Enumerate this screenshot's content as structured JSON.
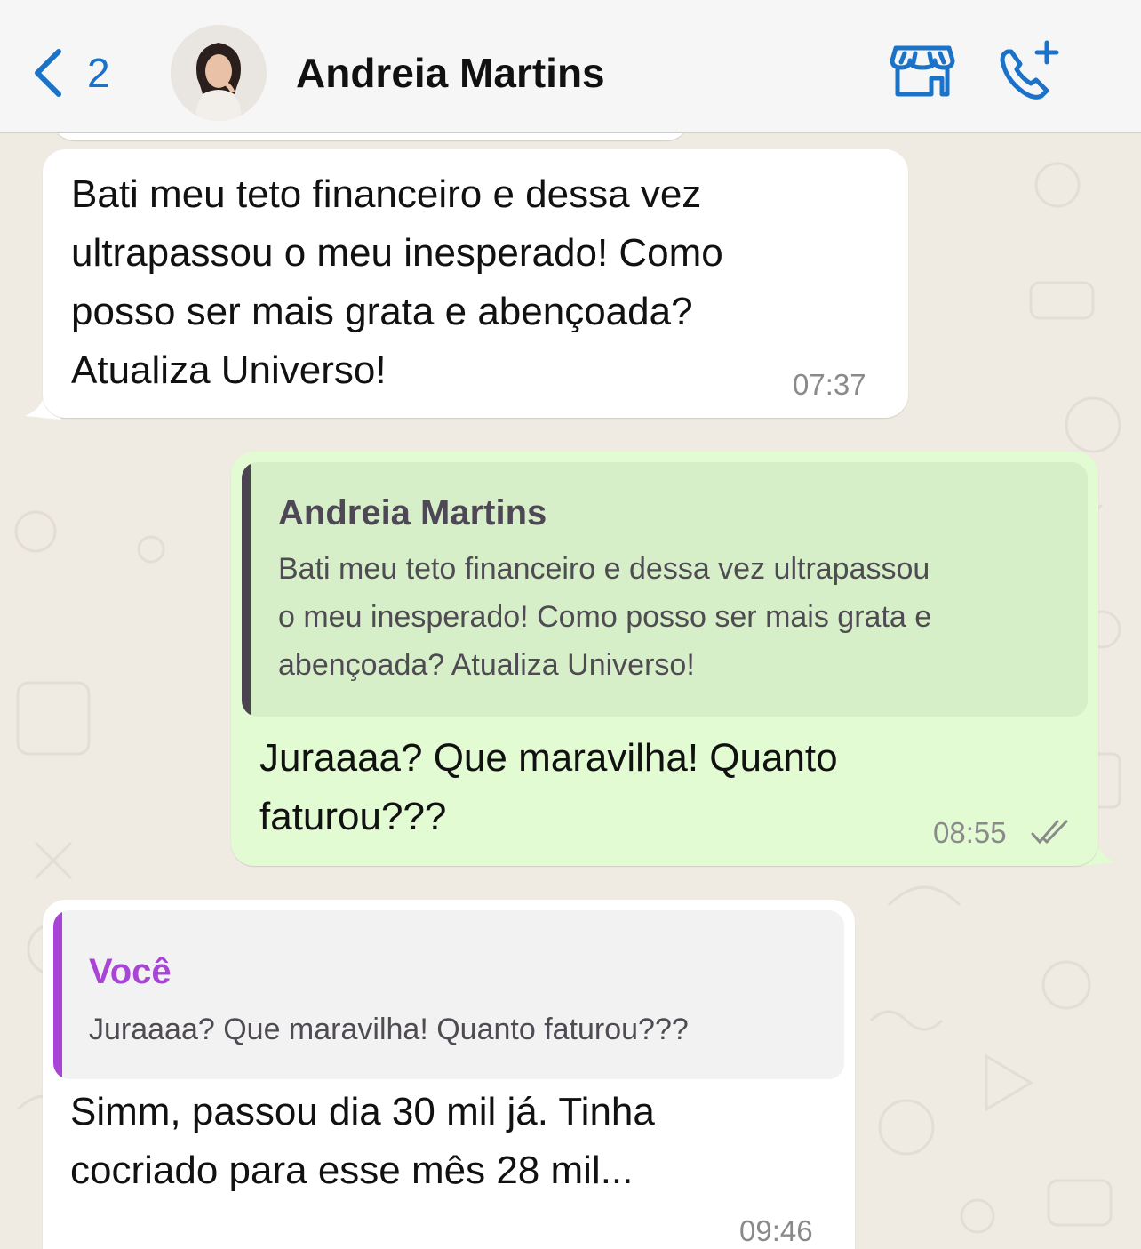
{
  "header": {
    "back_count": "2",
    "contact_name": "Andreia Martins",
    "accent_color": "#1a73c8"
  },
  "messages": [
    {
      "direction": "incoming",
      "text_lines": [
        "Bati meu teto financeiro e dessa vez",
        "ultrapassou o meu inesperado! Como",
        "posso ser mais grata e abençoada?",
        "Atualiza Universo!"
      ],
      "time": "07:37"
    },
    {
      "direction": "outgoing",
      "quote": {
        "name": "Andreia Martins",
        "text_lines": [
          "Bati meu teto financeiro e dessa vez ultrapassou",
          "o meu inesperado! Como posso ser mais grata e",
          "abençoada? Atualiza Universo!"
        ]
      },
      "text_lines": [
        "Juraaaa? Que maravilha! Quanto",
        "faturou???"
      ],
      "time": "08:55",
      "status": "read-ticks"
    },
    {
      "direction": "incoming",
      "quote": {
        "name": "Você",
        "text": "Juraaaa? Que maravilha! Quanto faturou???"
      },
      "text_lines": [
        "Simm, passou dia 30 mil já. Tinha",
        "cocriado para esse mês 28 mil..."
      ],
      "time": "09:46"
    }
  ],
  "colors": {
    "incoming_bubble": "#ffffff",
    "outgoing_bubble": "#e2fbd3",
    "quote_bar_contact": "#4a4450",
    "quote_bar_self": "#a845d6",
    "quote_name_self": "#a845d6"
  }
}
